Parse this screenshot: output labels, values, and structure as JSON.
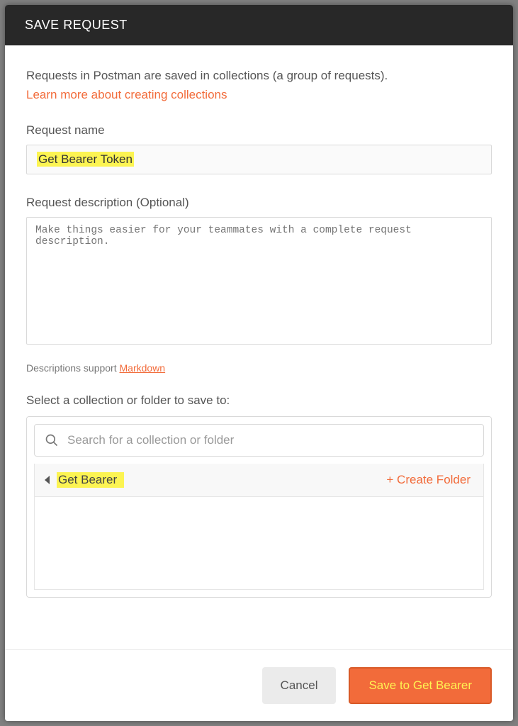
{
  "header": {
    "title": "SAVE REQUEST"
  },
  "intro": {
    "text": "Requests in Postman are saved in collections (a group of requests).",
    "link": "Learn more about creating collections"
  },
  "request_name": {
    "label": "Request name",
    "value": "Get Bearer Token"
  },
  "description": {
    "label": "Request description (Optional)",
    "placeholder": "Make things easier for your teammates with a complete request description.",
    "note_prefix": "Descriptions support ",
    "note_link": "Markdown"
  },
  "select": {
    "label": "Select a collection or folder to save to:",
    "search_placeholder": "Search for a collection or folder",
    "current_folder": "Get Bearer",
    "create_label": "+ Create Folder"
  },
  "footer": {
    "cancel": "Cancel",
    "save": "Save to Get Bearer"
  }
}
